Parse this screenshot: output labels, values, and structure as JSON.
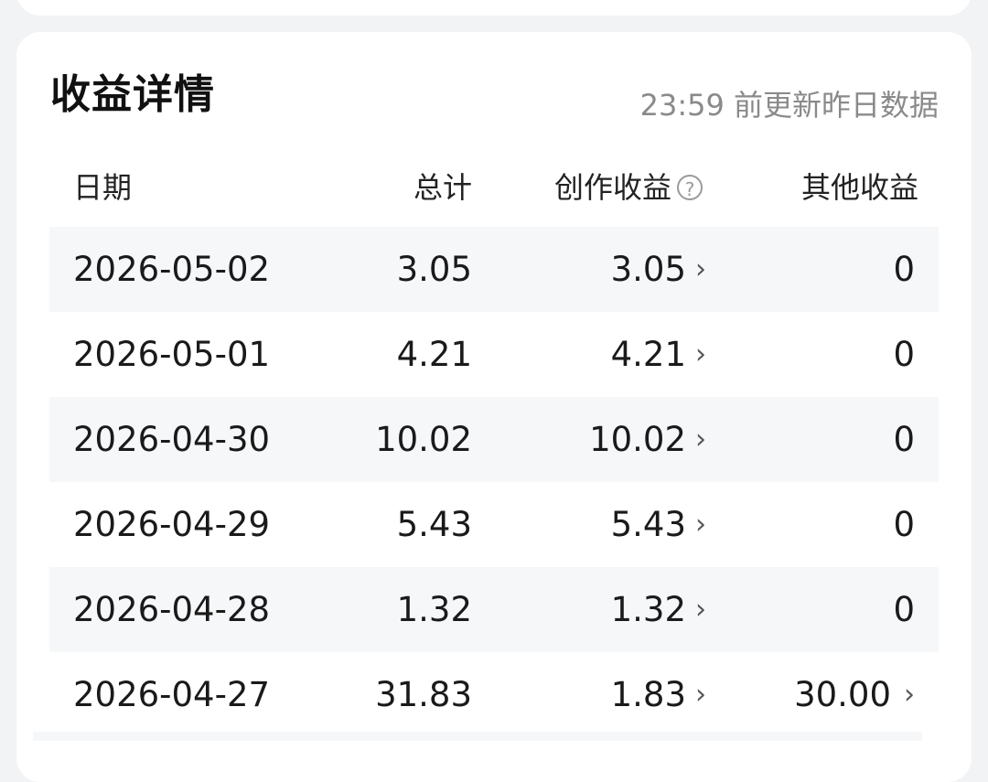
{
  "section": {
    "title": "收益详情",
    "update_note": "23:59 前更新昨日数据"
  },
  "table": {
    "headers": {
      "date": "日期",
      "total": "总计",
      "creation": "创作收益",
      "other": "其他收益"
    },
    "help_icon": "question-circle-icon",
    "rows": [
      {
        "date": "2026-05-02",
        "total": "3.05",
        "creation": "3.05",
        "other": "0"
      },
      {
        "date": "2026-05-01",
        "total": "4.21",
        "creation": "4.21",
        "other": "0"
      },
      {
        "date": "2026-04-30",
        "total": "10.02",
        "creation": "10.02",
        "other": "0"
      },
      {
        "date": "2026-04-29",
        "total": "5.43",
        "creation": "5.43",
        "other": "0"
      },
      {
        "date": "2026-04-28",
        "total": "1.32",
        "creation": "1.32",
        "other": "0"
      },
      {
        "date": "2026-04-27",
        "total": "31.83",
        "creation": "1.83",
        "other": "30.00"
      }
    ]
  },
  "colors": {
    "page_background": "#f2f3f5",
    "card_background": "#ffffff",
    "row_shade": "#f6f7f9",
    "muted_text": "#8a8a8a"
  }
}
